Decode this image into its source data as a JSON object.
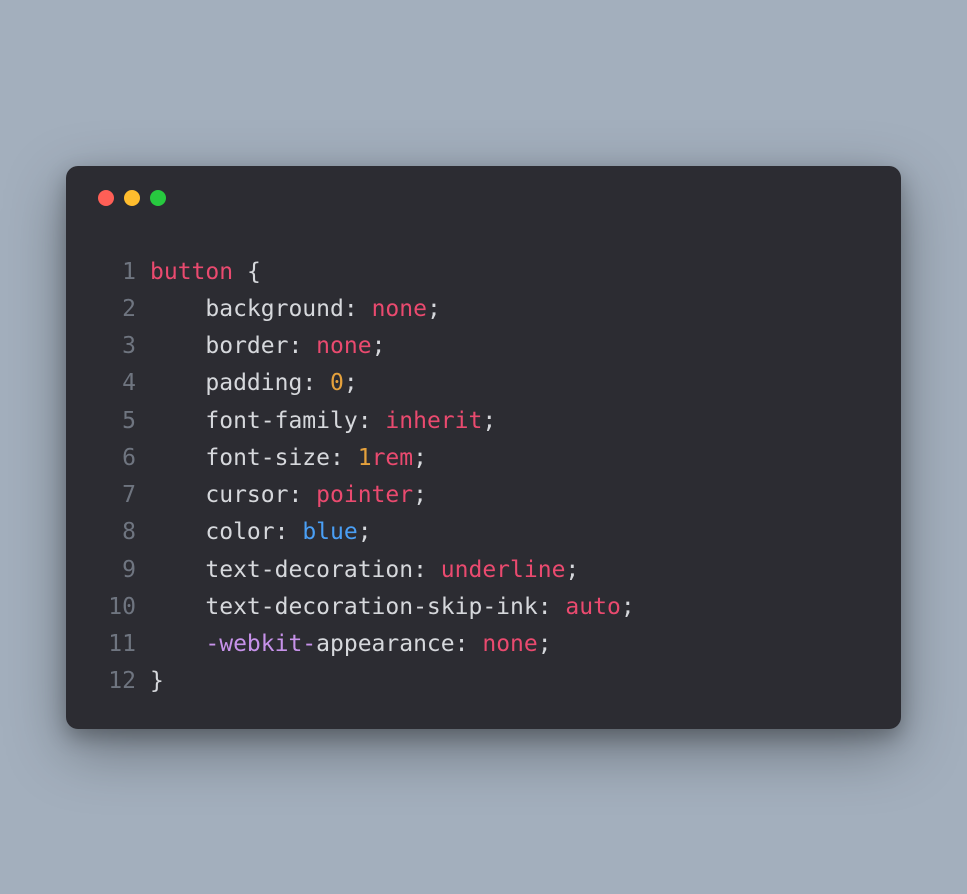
{
  "window": {
    "traffic_lights": {
      "red": "#ff5f56",
      "yellow": "#ffbd2e",
      "green": "#27c93f"
    }
  },
  "code": {
    "language": "css",
    "lines": [
      {
        "n": "1",
        "tokens": [
          {
            "t": "button",
            "c": "selector"
          },
          {
            "t": " ",
            "c": "punct"
          },
          {
            "t": "{",
            "c": "punct"
          }
        ]
      },
      {
        "n": "2",
        "indent": true,
        "tokens": [
          {
            "t": "background",
            "c": "prop"
          },
          {
            "t": ": ",
            "c": "punct"
          },
          {
            "t": "none",
            "c": "val-keyword"
          },
          {
            "t": ";",
            "c": "punct"
          }
        ]
      },
      {
        "n": "3",
        "indent": true,
        "tokens": [
          {
            "t": "border",
            "c": "prop"
          },
          {
            "t": ": ",
            "c": "punct"
          },
          {
            "t": "none",
            "c": "val-keyword"
          },
          {
            "t": ";",
            "c": "punct"
          }
        ]
      },
      {
        "n": "4",
        "indent": true,
        "tokens": [
          {
            "t": "padding",
            "c": "prop"
          },
          {
            "t": ": ",
            "c": "punct"
          },
          {
            "t": "0",
            "c": "val-number"
          },
          {
            "t": ";",
            "c": "punct"
          }
        ]
      },
      {
        "n": "5",
        "indent": true,
        "tokens": [
          {
            "t": "font-family",
            "c": "prop"
          },
          {
            "t": ": ",
            "c": "punct"
          },
          {
            "t": "inherit",
            "c": "val-keyword"
          },
          {
            "t": ";",
            "c": "punct"
          }
        ]
      },
      {
        "n": "6",
        "indent": true,
        "tokens": [
          {
            "t": "font-size",
            "c": "prop"
          },
          {
            "t": ": ",
            "c": "punct"
          },
          {
            "t": "1",
            "c": "val-number"
          },
          {
            "t": "rem",
            "c": "val-unit"
          },
          {
            "t": ";",
            "c": "punct"
          }
        ]
      },
      {
        "n": "7",
        "indent": true,
        "tokens": [
          {
            "t": "cursor",
            "c": "prop"
          },
          {
            "t": ": ",
            "c": "punct"
          },
          {
            "t": "pointer",
            "c": "val-keyword"
          },
          {
            "t": ";",
            "c": "punct"
          }
        ]
      },
      {
        "n": "8",
        "indent": true,
        "tokens": [
          {
            "t": "color",
            "c": "prop"
          },
          {
            "t": ": ",
            "c": "punct"
          },
          {
            "t": "blue",
            "c": "val-color"
          },
          {
            "t": ";",
            "c": "punct"
          }
        ]
      },
      {
        "n": "9",
        "indent": true,
        "tokens": [
          {
            "t": "text-decoration",
            "c": "prop"
          },
          {
            "t": ": ",
            "c": "punct"
          },
          {
            "t": "underline",
            "c": "val-keyword"
          },
          {
            "t": ";",
            "c": "punct"
          }
        ]
      },
      {
        "n": "10",
        "indent": true,
        "tokens": [
          {
            "t": "text-decoration-skip-ink",
            "c": "prop"
          },
          {
            "t": ": ",
            "c": "punct"
          },
          {
            "t": "auto",
            "c": "val-keyword"
          },
          {
            "t": ";",
            "c": "punct"
          }
        ]
      },
      {
        "n": "11",
        "indent": true,
        "tokens": [
          {
            "t": "-webkit-",
            "c": "vendor"
          },
          {
            "t": "appearance",
            "c": "prop"
          },
          {
            "t": ": ",
            "c": "punct"
          },
          {
            "t": "none",
            "c": "val-keyword"
          },
          {
            "t": ";",
            "c": "punct"
          }
        ]
      },
      {
        "n": "12",
        "tokens": [
          {
            "t": "}",
            "c": "punct"
          }
        ]
      }
    ]
  }
}
